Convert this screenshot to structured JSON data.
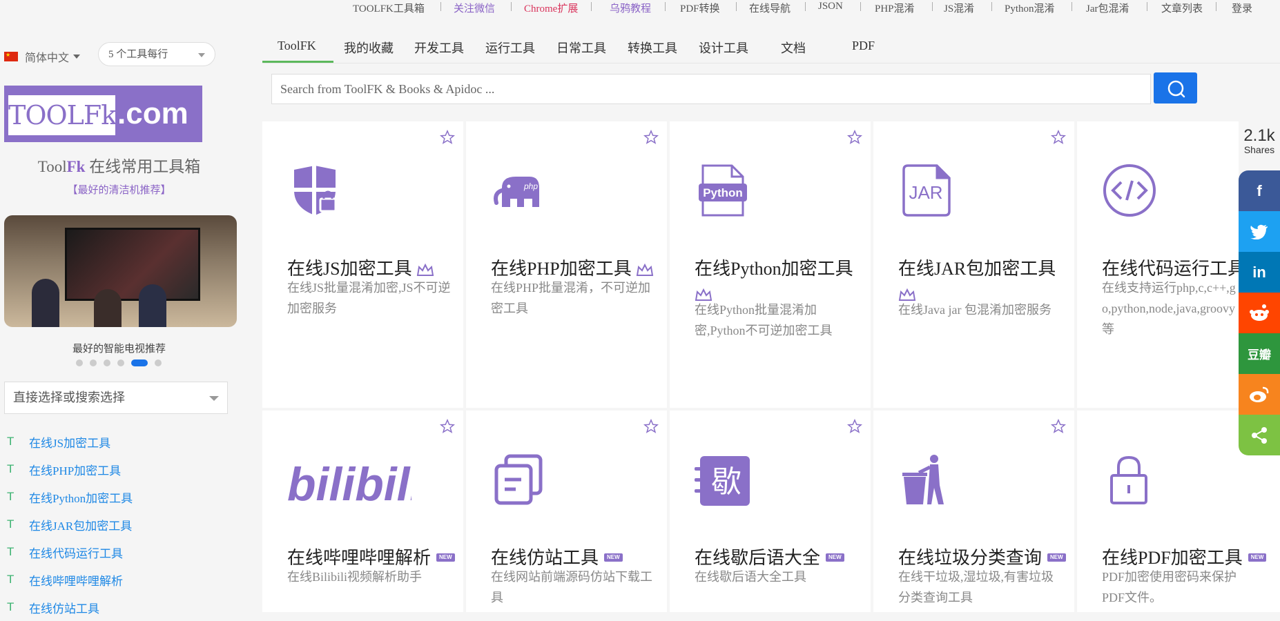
{
  "topnav": [
    {
      "label": "TOOLFK工具箱",
      "style": "normal"
    },
    {
      "label": "关注微信",
      "style": "purple"
    },
    {
      "label": "Chrome扩展",
      "style": "red"
    },
    {
      "label": "乌鸦教程",
      "style": "purple"
    },
    {
      "label": "PDF转换",
      "style": "normal"
    },
    {
      "label": "在线导航",
      "style": "normal"
    },
    {
      "label": "JSON",
      "style": "normal"
    },
    {
      "label": "PHP混淆",
      "style": "normal"
    },
    {
      "label": "JS混淆",
      "style": "normal"
    },
    {
      "label": "Python混淆",
      "style": "normal"
    },
    {
      "label": "Jar包混淆",
      "style": "normal"
    },
    {
      "label": "文章列表",
      "style": "normal"
    },
    {
      "label": "登录",
      "style": "normal"
    }
  ],
  "topnav_separator": "|",
  "sidebar": {
    "language": "简体中文",
    "per_row": "5 个工具每行",
    "logo_left": "TOOLFk",
    "logo_right": ".com",
    "title_prefix": "Tool",
    "title_fk": "Fk",
    "title_suffix": " 在线常用工具箱",
    "cleaner_link": "【最好的清洁机推荐】",
    "banner_caption": "最好的智能电视推荐",
    "select_placeholder": "直接选择或搜索选择",
    "tools": [
      "在线JS加密工具",
      "在线PHP加密工具",
      "在线Python加密工具",
      "在线JAR包加密工具",
      "在线代码运行工具",
      "在线哔哩哔哩解析",
      "在线仿站工具"
    ],
    "tool_icon_letter": "T"
  },
  "tabs": [
    "ToolFK",
    "我的收藏",
    "开发工具",
    "运行工具",
    "日常工具",
    "转换工具",
    "设计工具",
    "文档",
    "PDF"
  ],
  "active_tab": "ToolFK",
  "search": {
    "placeholder": "Search from ToolFK & Books & Apidoc ..."
  },
  "cards": [
    {
      "title": "在线JS加密工具",
      "desc": "在线JS批量混淆加密,JS不可逆加密服务",
      "icon": "shield-lock-icon",
      "badge": "crown"
    },
    {
      "title": "在线PHP加密工具",
      "desc": "在线PHP批量混淆，不可逆加密工具",
      "icon": "php-elephant-icon",
      "badge": "crown"
    },
    {
      "title": "在线Python加密工具",
      "desc": "在线Python批量混淆加密,Python不可逆加密工具",
      "icon": "python-file-icon",
      "badge": "crown"
    },
    {
      "title": "在线JAR包加密工具",
      "desc": "在线Java jar 包混淆加密服务",
      "icon": "jar-file-icon",
      "badge": "crown"
    },
    {
      "title": "在线代码运行工具",
      "desc": "在线支持运行php,c,c++,go,python,node,java,groovy等",
      "icon": "code-circle-icon",
      "badge": "crown"
    },
    {
      "title": "在线哔哩哔哩解析",
      "desc": "在线Bilibili视频解析助手",
      "icon": "bilibili-logo-icon",
      "badge": "new"
    },
    {
      "title": "在线仿站工具",
      "desc": "在线网站前端源码仿站下载工具",
      "icon": "copy-docs-icon",
      "badge": "new"
    },
    {
      "title": "在线歇后语大全",
      "desc": "在线歇后语大全工具",
      "icon": "song-icon",
      "badge": "new"
    },
    {
      "title": "在线垃圾分类查询",
      "desc": "在线干垃圾,湿垃圾,有害垃圾分类查询工具",
      "icon": "trash-person-icon",
      "badge": "new"
    },
    {
      "title": "在线PDF加密工具",
      "desc": "PDF加密使用密码来保护PDF文件。",
      "icon": "padlock-icon",
      "badge": "new"
    }
  ],
  "badges": {
    "new": "NEW"
  },
  "python_label": "Python",
  "jar_label": "JAR",
  "song_char": "歇",
  "bilibili_text": "bilibili",
  "share": {
    "count": "2.1k",
    "label": "Shares",
    "buttons": [
      {
        "name": "facebook",
        "glyph": "f",
        "color": "#3b5998"
      },
      {
        "name": "twitter",
        "glyph": "t",
        "color": "#1da1f2"
      },
      {
        "name": "linkedin",
        "glyph": "in",
        "color": "#0077b5"
      },
      {
        "name": "reddit",
        "glyph": "r",
        "color": "#ff4500"
      },
      {
        "name": "douban",
        "glyph": "豆瓣",
        "color": "#2e963d"
      },
      {
        "name": "weibo",
        "glyph": "微",
        "color": "#f7841e"
      },
      {
        "name": "share",
        "glyph": "<",
        "color": "#7dc243"
      }
    ]
  },
  "colors": {
    "accent": "#8a70c8",
    "link": "#1e88e5",
    "search_button": "#1a73e8",
    "tab_underline": "#5cb85c"
  }
}
